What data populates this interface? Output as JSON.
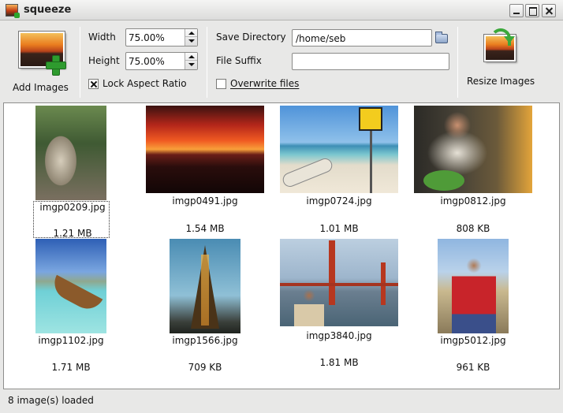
{
  "window": {
    "title": "squeeze"
  },
  "toolbar": {
    "add_images_label": "Add Images",
    "resize_images_label": "Resize Images",
    "width_label": "Width",
    "width_value": "75.00%",
    "height_label": "Height",
    "height_value": "75.00%",
    "lock_aspect_label": "Lock Aspect Ratio",
    "lock_aspect_checked": true,
    "save_directory_label": "Save Directory",
    "save_directory_value": "/home/seb",
    "file_suffix_label": "File Suffix",
    "file_suffix_value": "",
    "overwrite_label": "Overwrite files",
    "overwrite_checked": false
  },
  "images": [
    {
      "name": "imgp0209.jpg",
      "size": "1.21 MB",
      "icon": "stone-face-statue-photo"
    },
    {
      "name": "imgp0491.jpg",
      "size": "1.54 MB",
      "icon": "sunset-sea-photo"
    },
    {
      "name": "imgp0724.jpg",
      "size": "1.01 MB",
      "icon": "beach-sign-photo"
    },
    {
      "name": "imgp0812.jpg",
      "size": "808 KB",
      "icon": "dinner-table-photo"
    },
    {
      "name": "imgp1102.jpg",
      "size": "1.71 MB",
      "icon": "longtail-boat-photo"
    },
    {
      "name": "imgp1566.jpg",
      "size": "709 KB",
      "icon": "eiffel-tower-photo"
    },
    {
      "name": "imgp3840.jpg",
      "size": "1.81 MB",
      "icon": "golden-gate-bridge-photo"
    },
    {
      "name": "imgp5012.jpg",
      "size": "961 KB",
      "icon": "man-red-jacket-photo"
    }
  ],
  "status": {
    "text": "8 image(s) loaded"
  }
}
